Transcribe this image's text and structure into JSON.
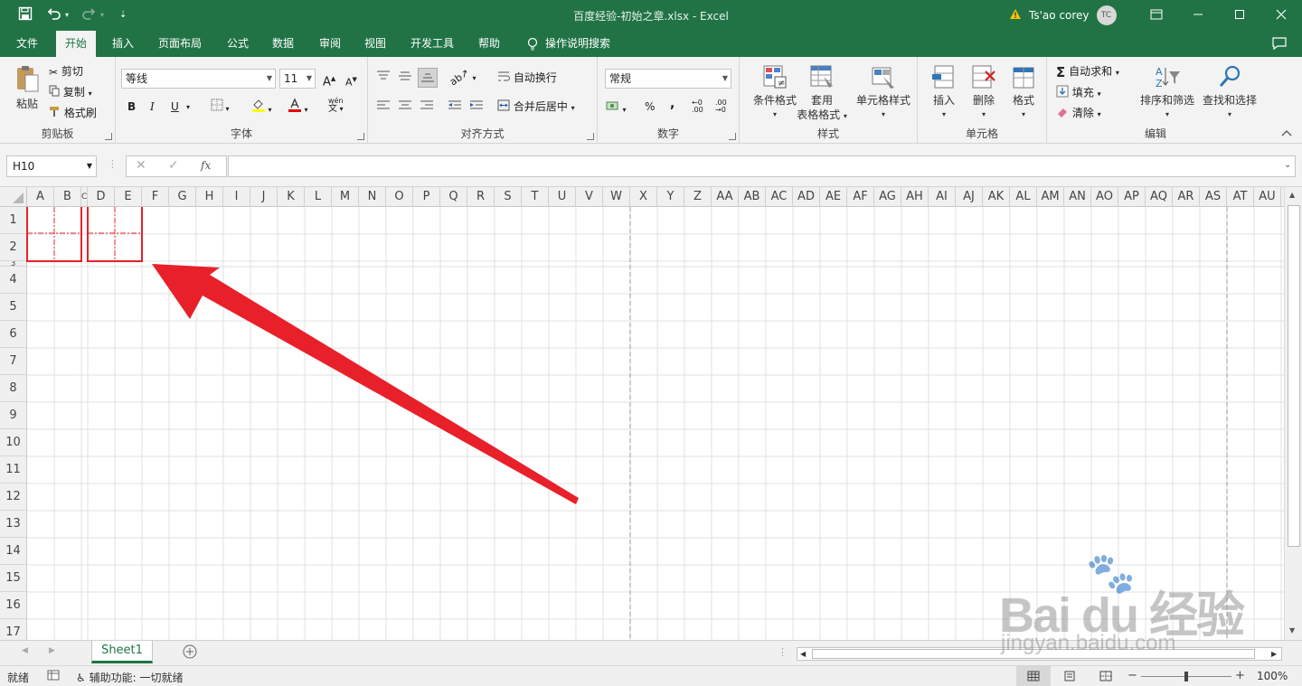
{
  "title_bar": {
    "doc_title": "百度经验-初始之章.xlsx  -  Excel",
    "user_name": "Ts'ao corey",
    "user_initials": "TC"
  },
  "tabs": [
    {
      "label": "文件"
    },
    {
      "label": "开始",
      "active": true
    },
    {
      "label": "插入"
    },
    {
      "label": "页面布局"
    },
    {
      "label": "公式"
    },
    {
      "label": "数据"
    },
    {
      "label": "审阅"
    },
    {
      "label": "视图"
    },
    {
      "label": "开发工具"
    },
    {
      "label": "帮助"
    },
    {
      "label": "操作说明搜索"
    }
  ],
  "ribbon": {
    "clipboard": {
      "paste": "粘贴",
      "cut": "剪切",
      "copy": "复制",
      "format_painter": "格式刷",
      "label": "剪贴板"
    },
    "font": {
      "family": "等线",
      "size": "11",
      "label": "字体",
      "bold": "B",
      "italic": "I",
      "underline": "U"
    },
    "alignment": {
      "wrap_text": "自动换行",
      "merge_center": "合并后居中",
      "label": "对齐方式"
    },
    "number": {
      "format": "常规",
      "label": "数字",
      "percent": "%",
      "comma": ","
    },
    "styles": {
      "conditional": "条件格式",
      "table_a": "套用",
      "table_b": "表格格式",
      "cell_styles": "单元格样式",
      "label": "样式"
    },
    "cells": {
      "insert": "插入",
      "delete": "删除",
      "format": "格式",
      "label": "单元格"
    },
    "editing": {
      "autosum": "自动求和",
      "fill": "填充",
      "clear": "清除",
      "sort_filter": "排序和筛选",
      "find_select": "查找和选择",
      "label": "编辑"
    }
  },
  "formula_bar": {
    "name_box": "H10",
    "fx": "fx",
    "formula": ""
  },
  "columns": [
    "A",
    "B",
    "C",
    "D",
    "E",
    "F",
    "G",
    "H",
    "I",
    "J",
    "K",
    "L",
    "M",
    "N",
    "O",
    "P",
    "Q",
    "R",
    "S",
    "T",
    "U",
    "V",
    "W",
    "X",
    "Y",
    "Z",
    "AA",
    "AB",
    "AC",
    "AD",
    "AE",
    "AF",
    "AG",
    "AH",
    "AI",
    "AJ",
    "AK",
    "AL",
    "AM",
    "AN",
    "AO",
    "AP",
    "AQ",
    "AR",
    "AS",
    "AT",
    "AU"
  ],
  "rows": [
    "1",
    "2",
    "3",
    "4",
    "5",
    "6",
    "7",
    "8",
    "9",
    "10",
    "11",
    "12",
    "13",
    "14",
    "15",
    "16",
    "17"
  ],
  "sheets": [
    {
      "name": "Sheet1",
      "active": true
    }
  ],
  "status_bar": {
    "ready": "就绪",
    "accessibility": "辅助功能: 一切就绪",
    "zoom": "100%"
  },
  "watermark": {
    "brand": "Bai du 经验",
    "url": "jingyan.baidu.com"
  },
  "colors": {
    "accent": "#217346",
    "annotation": "#e8202a"
  }
}
